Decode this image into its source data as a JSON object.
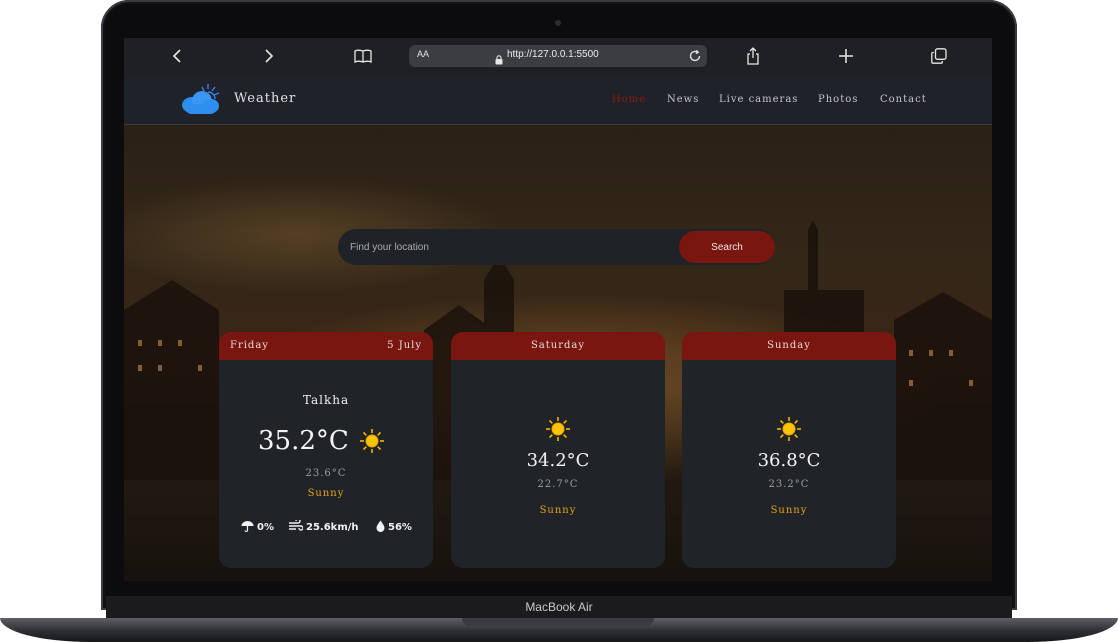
{
  "device": {
    "label": "MacBook Air"
  },
  "browser": {
    "text_size_label": "AA",
    "url": "http://127.0.0.1:5500"
  },
  "site": {
    "brand": "Weather",
    "nav": [
      "Home",
      "News",
      "Live cameras",
      "Photos",
      "Contact"
    ],
    "active_nav": "Home",
    "accent_color": "#7a1610",
    "search": {
      "placeholder": "Find your location",
      "button_label": "Search"
    }
  },
  "forecast": {
    "today": {
      "day": "Friday",
      "date": "5 July",
      "city": "Talkha",
      "temp": "35.2°C",
      "low": "23.6°C",
      "condition": "Sunny",
      "icon": "sun-icon",
      "rain": "0%",
      "wind": "25.6km/h",
      "humidity": "56%"
    },
    "next": [
      {
        "day": "Saturday",
        "temp": "34.2°C",
        "low": "22.7°C",
        "condition": "Sunny",
        "icon": "sun-icon"
      },
      {
        "day": "Sunday",
        "temp": "36.8°C",
        "low": "23.2°C",
        "condition": "Sunny",
        "icon": "sun-icon"
      }
    ]
  }
}
